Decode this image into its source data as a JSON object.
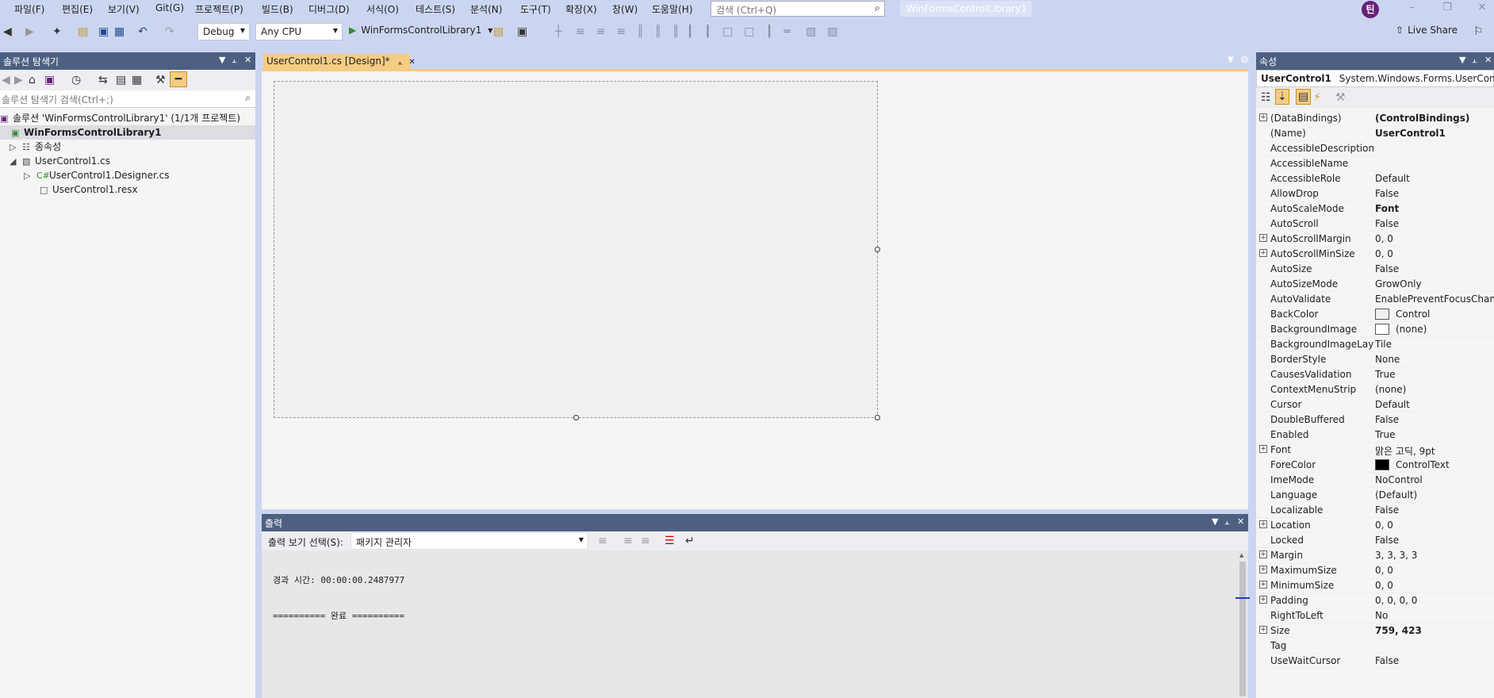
{
  "menu": [
    "파일(F)",
    "편집(E)",
    "보기(V)",
    "Git(G)",
    "프로젝트(P)",
    "빌드(B)",
    "디버그(D)",
    "서식(O)",
    "테스트(S)",
    "분석(N)",
    "도구(T)",
    "확장(X)",
    "창(W)",
    "도움말(H)"
  ],
  "search": {
    "placeholder": "검색 (Ctrl+Q)",
    "icon": "search-icon"
  },
  "window_title": "WinFormsControlLibrary1",
  "avatar_initial": "틴",
  "toolbar": {
    "config": "Debug",
    "platform": "Any CPU",
    "start_label": "WinFormsControlLibrary1",
    "live_share": "Live Share"
  },
  "solution_explorer": {
    "title": "솔루션 탐색기",
    "search_placeholder": "솔루션 탐색기 검색(Ctrl+;)",
    "items": [
      {
        "label": "솔루션 'WinFormsControlLibrary1' (1/1개 프로젝트)",
        "icon": "solution-icon"
      },
      {
        "label": "WinFormsControlLibrary1",
        "icon": "csharp-project-icon"
      },
      {
        "label": "종속성",
        "icon": "dependencies-icon"
      },
      {
        "label": "UserControl1.cs",
        "icon": "usercontrol-icon"
      },
      {
        "label": "UserControl1.Designer.cs",
        "icon": "csharp-file-icon"
      },
      {
        "label": "UserControl1.resx",
        "icon": "resx-file-icon"
      }
    ]
  },
  "document_tab": {
    "label": "UserControl1.cs [Design]*"
  },
  "output": {
    "title": "출력",
    "show_label": "출력 보기 선택(S):",
    "source": "패키지 관리자",
    "lines": [
      "경과 시간: 00:00:00.2487977",
      "========== 완료 =========="
    ]
  },
  "properties": {
    "title": "속성",
    "object_name": "UserControl1",
    "object_type": "System.Windows.Forms.UserControl",
    "rows": [
      {
        "name": "(DataBindings)",
        "value": "(ControlBindings)",
        "expand": true,
        "bold": true
      },
      {
        "name": "(Name)",
        "value": "UserControl1",
        "bold": true
      },
      {
        "name": "AccessibleDescription",
        "value": ""
      },
      {
        "name": "AccessibleName",
        "value": ""
      },
      {
        "name": "AccessibleRole",
        "value": "Default"
      },
      {
        "name": "AllowDrop",
        "value": "False"
      },
      {
        "name": "AutoScaleMode",
        "value": "Font",
        "bold": true
      },
      {
        "name": "AutoScroll",
        "value": "False"
      },
      {
        "name": "AutoScrollMargin",
        "value": "0, 0",
        "expand": true
      },
      {
        "name": "AutoScrollMinSize",
        "value": "0, 0",
        "expand": true
      },
      {
        "name": "AutoSize",
        "value": "False"
      },
      {
        "name": "AutoSizeMode",
        "value": "GrowOnly"
      },
      {
        "name": "AutoValidate",
        "value": "EnablePreventFocusChange"
      },
      {
        "name": "BackColor",
        "value": "Control",
        "swatch": "#f0f0f0"
      },
      {
        "name": "BackgroundImage",
        "value": "(none)",
        "swatch": "#ffffff"
      },
      {
        "name": "BackgroundImageLayout",
        "value": "Tile"
      },
      {
        "name": "BorderStyle",
        "value": "None"
      },
      {
        "name": "CausesValidation",
        "value": "True"
      },
      {
        "name": "ContextMenuStrip",
        "value": "(none)"
      },
      {
        "name": "Cursor",
        "value": "Default"
      },
      {
        "name": "DoubleBuffered",
        "value": "False"
      },
      {
        "name": "Enabled",
        "value": "True"
      },
      {
        "name": "Font",
        "value": "맑은 고딕, 9pt",
        "expand": true
      },
      {
        "name": "ForeColor",
        "value": "ControlText",
        "swatch": "#000000"
      },
      {
        "name": "ImeMode",
        "value": "NoControl"
      },
      {
        "name": "Language",
        "value": "(Default)"
      },
      {
        "name": "Localizable",
        "value": "False"
      },
      {
        "name": "Location",
        "value": "0, 0",
        "expand": true
      },
      {
        "name": "Locked",
        "value": "False"
      },
      {
        "name": "Margin",
        "value": "3, 3, 3, 3",
        "expand": true
      },
      {
        "name": "MaximumSize",
        "value": "0, 0",
        "expand": true
      },
      {
        "name": "MinimumSize",
        "value": "0, 0",
        "expand": true
      },
      {
        "name": "Padding",
        "value": "0, 0, 0, 0",
        "expand": true
      },
      {
        "name": "RightToLeft",
        "value": "No"
      },
      {
        "name": "Size",
        "value": "759, 423",
        "expand": true,
        "bold": true
      },
      {
        "name": "Tag",
        "value": ""
      },
      {
        "name": "UseWaitCursor",
        "value": "False"
      }
    ]
  },
  "colors": {
    "panel_title": "#4d6082",
    "active_tab": "#f5cc84",
    "chrome": "#ccd5f0"
  }
}
